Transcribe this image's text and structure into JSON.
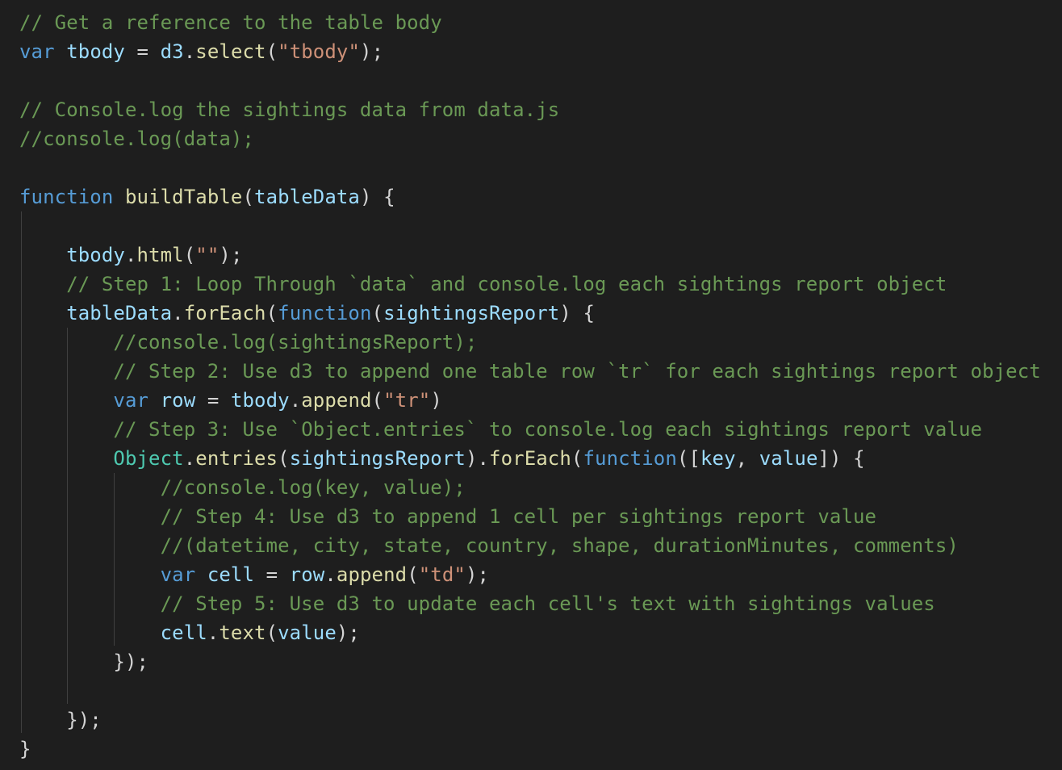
{
  "editor": {
    "language": "javascript",
    "theme": "dark",
    "colors": {
      "background": "#1e1e1e",
      "comment": "#6a9955",
      "keyword": "#569cd6",
      "variable": "#9cdcfe",
      "function": "#dcdcaa",
      "string": "#ce9178",
      "punctuation": "#d4d4d4",
      "class": "#4ec9b0",
      "indent_guide": "#404040"
    },
    "lines": [
      [
        {
          "t": "c",
          "x": "// Get a reference to the table body"
        }
      ],
      [
        {
          "t": "k",
          "x": "var"
        },
        {
          "t": "p",
          "x": " "
        },
        {
          "t": "v",
          "x": "tbody"
        },
        {
          "t": "p",
          "x": " = "
        },
        {
          "t": "v",
          "x": "d3"
        },
        {
          "t": "p",
          "x": "."
        },
        {
          "t": "f",
          "x": "select"
        },
        {
          "t": "p",
          "x": "("
        },
        {
          "t": "s",
          "x": "\"tbody\""
        },
        {
          "t": "p",
          "x": ");"
        }
      ],
      [],
      [
        {
          "t": "c",
          "x": "// Console.log the sightings data from data.js"
        }
      ],
      [
        {
          "t": "c",
          "x": "//console.log(data);"
        }
      ],
      [],
      [
        {
          "t": "k",
          "x": "function"
        },
        {
          "t": "p",
          "x": " "
        },
        {
          "t": "f",
          "x": "buildTable"
        },
        {
          "t": "p",
          "x": "("
        },
        {
          "t": "v",
          "x": "tableData"
        },
        {
          "t": "p",
          "x": ") {"
        }
      ],
      [],
      [
        {
          "t": "p",
          "x": "    "
        },
        {
          "t": "v",
          "x": "tbody"
        },
        {
          "t": "p",
          "x": "."
        },
        {
          "t": "f",
          "x": "html"
        },
        {
          "t": "p",
          "x": "("
        },
        {
          "t": "s",
          "x": "\"\""
        },
        {
          "t": "p",
          "x": ");"
        }
      ],
      [
        {
          "t": "p",
          "x": "    "
        },
        {
          "t": "c",
          "x": "// Step 1: Loop Through `data` and console.log each sightings report object"
        }
      ],
      [
        {
          "t": "p",
          "x": "    "
        },
        {
          "t": "v",
          "x": "tableData"
        },
        {
          "t": "p",
          "x": "."
        },
        {
          "t": "f",
          "x": "forEach"
        },
        {
          "t": "p",
          "x": "("
        },
        {
          "t": "k",
          "x": "function"
        },
        {
          "t": "p",
          "x": "("
        },
        {
          "t": "v",
          "x": "sightingsReport"
        },
        {
          "t": "p",
          "x": ") {"
        }
      ],
      [
        {
          "t": "p",
          "x": "        "
        },
        {
          "t": "c",
          "x": "//console.log(sightingsReport);"
        }
      ],
      [
        {
          "t": "p",
          "x": "        "
        },
        {
          "t": "c",
          "x": "// Step 2: Use d3 to append one table row `tr` for each sightings report object"
        }
      ],
      [
        {
          "t": "p",
          "x": "        "
        },
        {
          "t": "k",
          "x": "var"
        },
        {
          "t": "p",
          "x": " "
        },
        {
          "t": "v",
          "x": "row"
        },
        {
          "t": "p",
          "x": " = "
        },
        {
          "t": "v",
          "x": "tbody"
        },
        {
          "t": "p",
          "x": "."
        },
        {
          "t": "f",
          "x": "append"
        },
        {
          "t": "p",
          "x": "("
        },
        {
          "t": "s",
          "x": "\"tr\""
        },
        {
          "t": "p",
          "x": ")"
        }
      ],
      [
        {
          "t": "p",
          "x": "        "
        },
        {
          "t": "c",
          "x": "// Step 3: Use `Object.entries` to console.log each sightings report value"
        }
      ],
      [
        {
          "t": "p",
          "x": "        "
        },
        {
          "t": "t",
          "x": "Object"
        },
        {
          "t": "p",
          "x": "."
        },
        {
          "t": "f",
          "x": "entries"
        },
        {
          "t": "p",
          "x": "("
        },
        {
          "t": "v",
          "x": "sightingsReport"
        },
        {
          "t": "p",
          "x": ")."
        },
        {
          "t": "f",
          "x": "forEach"
        },
        {
          "t": "p",
          "x": "("
        },
        {
          "t": "k",
          "x": "function"
        },
        {
          "t": "p",
          "x": "(["
        },
        {
          "t": "v",
          "x": "key"
        },
        {
          "t": "p",
          "x": ", "
        },
        {
          "t": "v",
          "x": "value"
        },
        {
          "t": "p",
          "x": "]) {"
        }
      ],
      [
        {
          "t": "p",
          "x": "            "
        },
        {
          "t": "c",
          "x": "//console.log(key, value);"
        }
      ],
      [
        {
          "t": "p",
          "x": "            "
        },
        {
          "t": "c",
          "x": "// Step 4: Use d3 to append 1 cell per sightings report value"
        }
      ],
      [
        {
          "t": "p",
          "x": "            "
        },
        {
          "t": "c",
          "x": "//(datetime, city, state, country, shape, durationMinutes, comments)"
        }
      ],
      [
        {
          "t": "p",
          "x": "            "
        },
        {
          "t": "k",
          "x": "var"
        },
        {
          "t": "p",
          "x": " "
        },
        {
          "t": "v",
          "x": "cell"
        },
        {
          "t": "p",
          "x": " = "
        },
        {
          "t": "v",
          "x": "row"
        },
        {
          "t": "p",
          "x": "."
        },
        {
          "t": "f",
          "x": "append"
        },
        {
          "t": "p",
          "x": "("
        },
        {
          "t": "s",
          "x": "\"td\""
        },
        {
          "t": "p",
          "x": ");"
        }
      ],
      [
        {
          "t": "p",
          "x": "            "
        },
        {
          "t": "c",
          "x": "// Step 5: Use d3 to update each cell's text with sightings values"
        }
      ],
      [
        {
          "t": "p",
          "x": "            "
        },
        {
          "t": "v",
          "x": "cell"
        },
        {
          "t": "p",
          "x": "."
        },
        {
          "t": "f",
          "x": "text"
        },
        {
          "t": "p",
          "x": "("
        },
        {
          "t": "v",
          "x": "value"
        },
        {
          "t": "p",
          "x": ");"
        }
      ],
      [
        {
          "t": "p",
          "x": "        });"
        }
      ],
      [],
      [
        {
          "t": "p",
          "x": "    });"
        }
      ],
      [
        {
          "t": "p",
          "x": "}"
        }
      ]
    ]
  }
}
